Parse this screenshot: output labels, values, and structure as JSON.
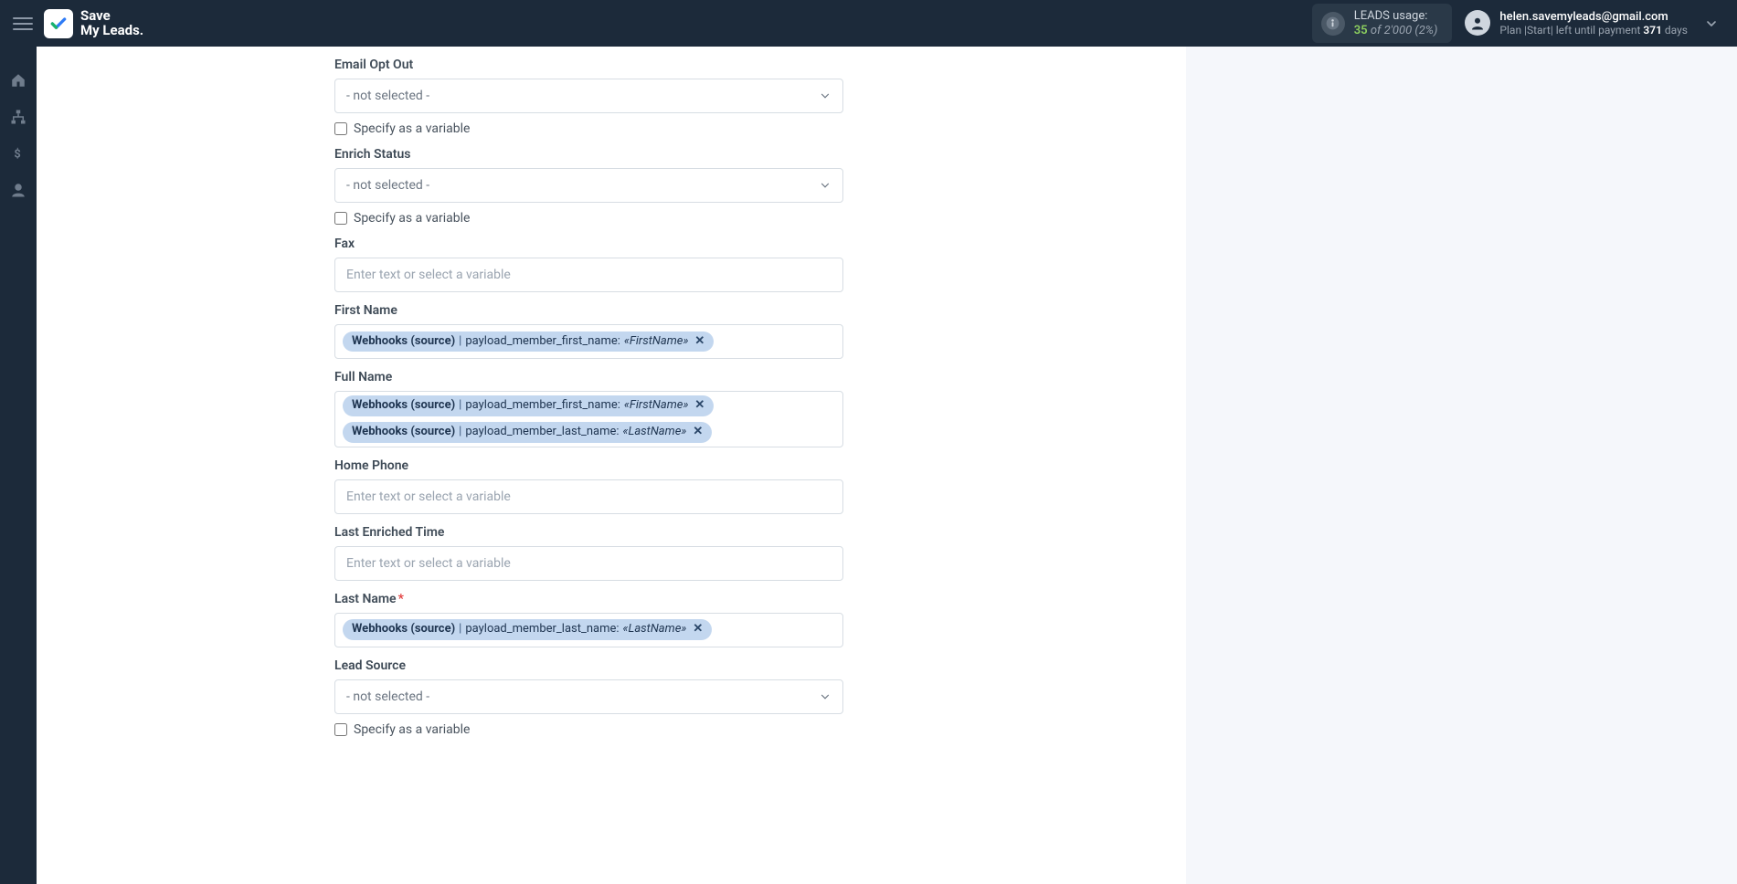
{
  "brand": {
    "line1": "Save",
    "line2": "My Leads."
  },
  "usage": {
    "label": "LEADS usage:",
    "count": "35",
    "of_word": "of",
    "total": "2'000",
    "pct": "(2%)"
  },
  "account": {
    "email": "helen.savemyleads@gmail.com",
    "plan_prefix": "Plan |Start| left until payment ",
    "plan_days": "371",
    "plan_suffix": " days"
  },
  "common": {
    "not_selected": "- not selected -",
    "enter_text": "Enter text or select a variable",
    "specify_var": "Specify as a variable",
    "token_source": "Webhooks (source)"
  },
  "fields": {
    "email_opt_out": {
      "label": "Email Opt Out"
    },
    "enrich_status": {
      "label": "Enrich Status"
    },
    "fax": {
      "label": "Fax"
    },
    "first_name": {
      "label": "First Name",
      "token_field": "payload_member_first_name:",
      "token_value": "«FirstName»"
    },
    "full_name": {
      "label": "Full Name",
      "t1_field": "payload_member_first_name:",
      "t1_value": "«FirstName»",
      "t2_field": "payload_member_last_name:",
      "t2_value": "«LastName»"
    },
    "home_phone": {
      "label": "Home Phone"
    },
    "last_enriched": {
      "label": "Last Enriched Time"
    },
    "last_name": {
      "label": "Last Name",
      "token_field": "payload_member_last_name:",
      "token_value": "«LastName»"
    },
    "lead_source": {
      "label": "Lead Source"
    }
  }
}
